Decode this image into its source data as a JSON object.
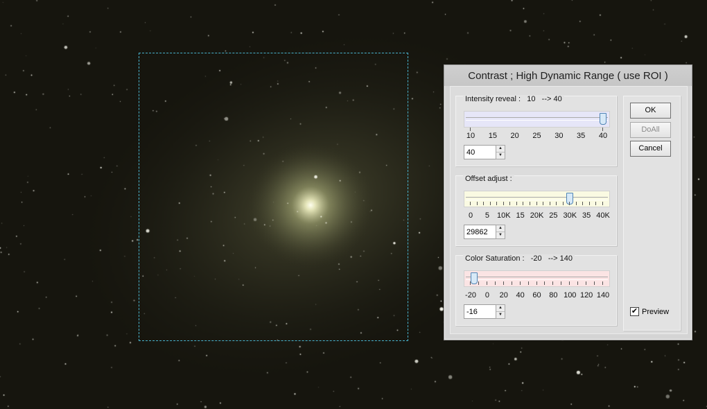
{
  "dialog": {
    "title": "Contrast ; High Dynamic Range  ( use ROI )",
    "intensity": {
      "label": "Intensity reveal :   10   --> 40",
      "scale": [
        "10",
        "15",
        "20",
        "25",
        "30",
        "35",
        "40"
      ],
      "min": 10,
      "max": 40,
      "value": "40",
      "track_color": "#e6e6f8"
    },
    "offset": {
      "label": "Offset adjust :",
      "scale": [
        "0",
        "5",
        "10K",
        "15",
        "20K",
        "25",
        "30K",
        "35",
        "40K"
      ],
      "min": 0,
      "max": 40000,
      "value": "29862",
      "track_color": "#fafae2"
    },
    "saturation": {
      "label": "Color Saturation :   -20   --> 140",
      "scale": [
        "-20",
        "0",
        "20",
        "40",
        "60",
        "80",
        "100",
        "120",
        "140"
      ],
      "min": -20,
      "max": 140,
      "value": "-16",
      "track_color": "#fbe4e4"
    },
    "buttons": {
      "ok": "OK",
      "doall": "DoAll",
      "cancel": "Cancel"
    },
    "preview": {
      "label": "Preview",
      "checked": true,
      "check_glyph": "✔"
    }
  },
  "icons": {
    "spin_up": "▲",
    "spin_down": "▼"
  }
}
